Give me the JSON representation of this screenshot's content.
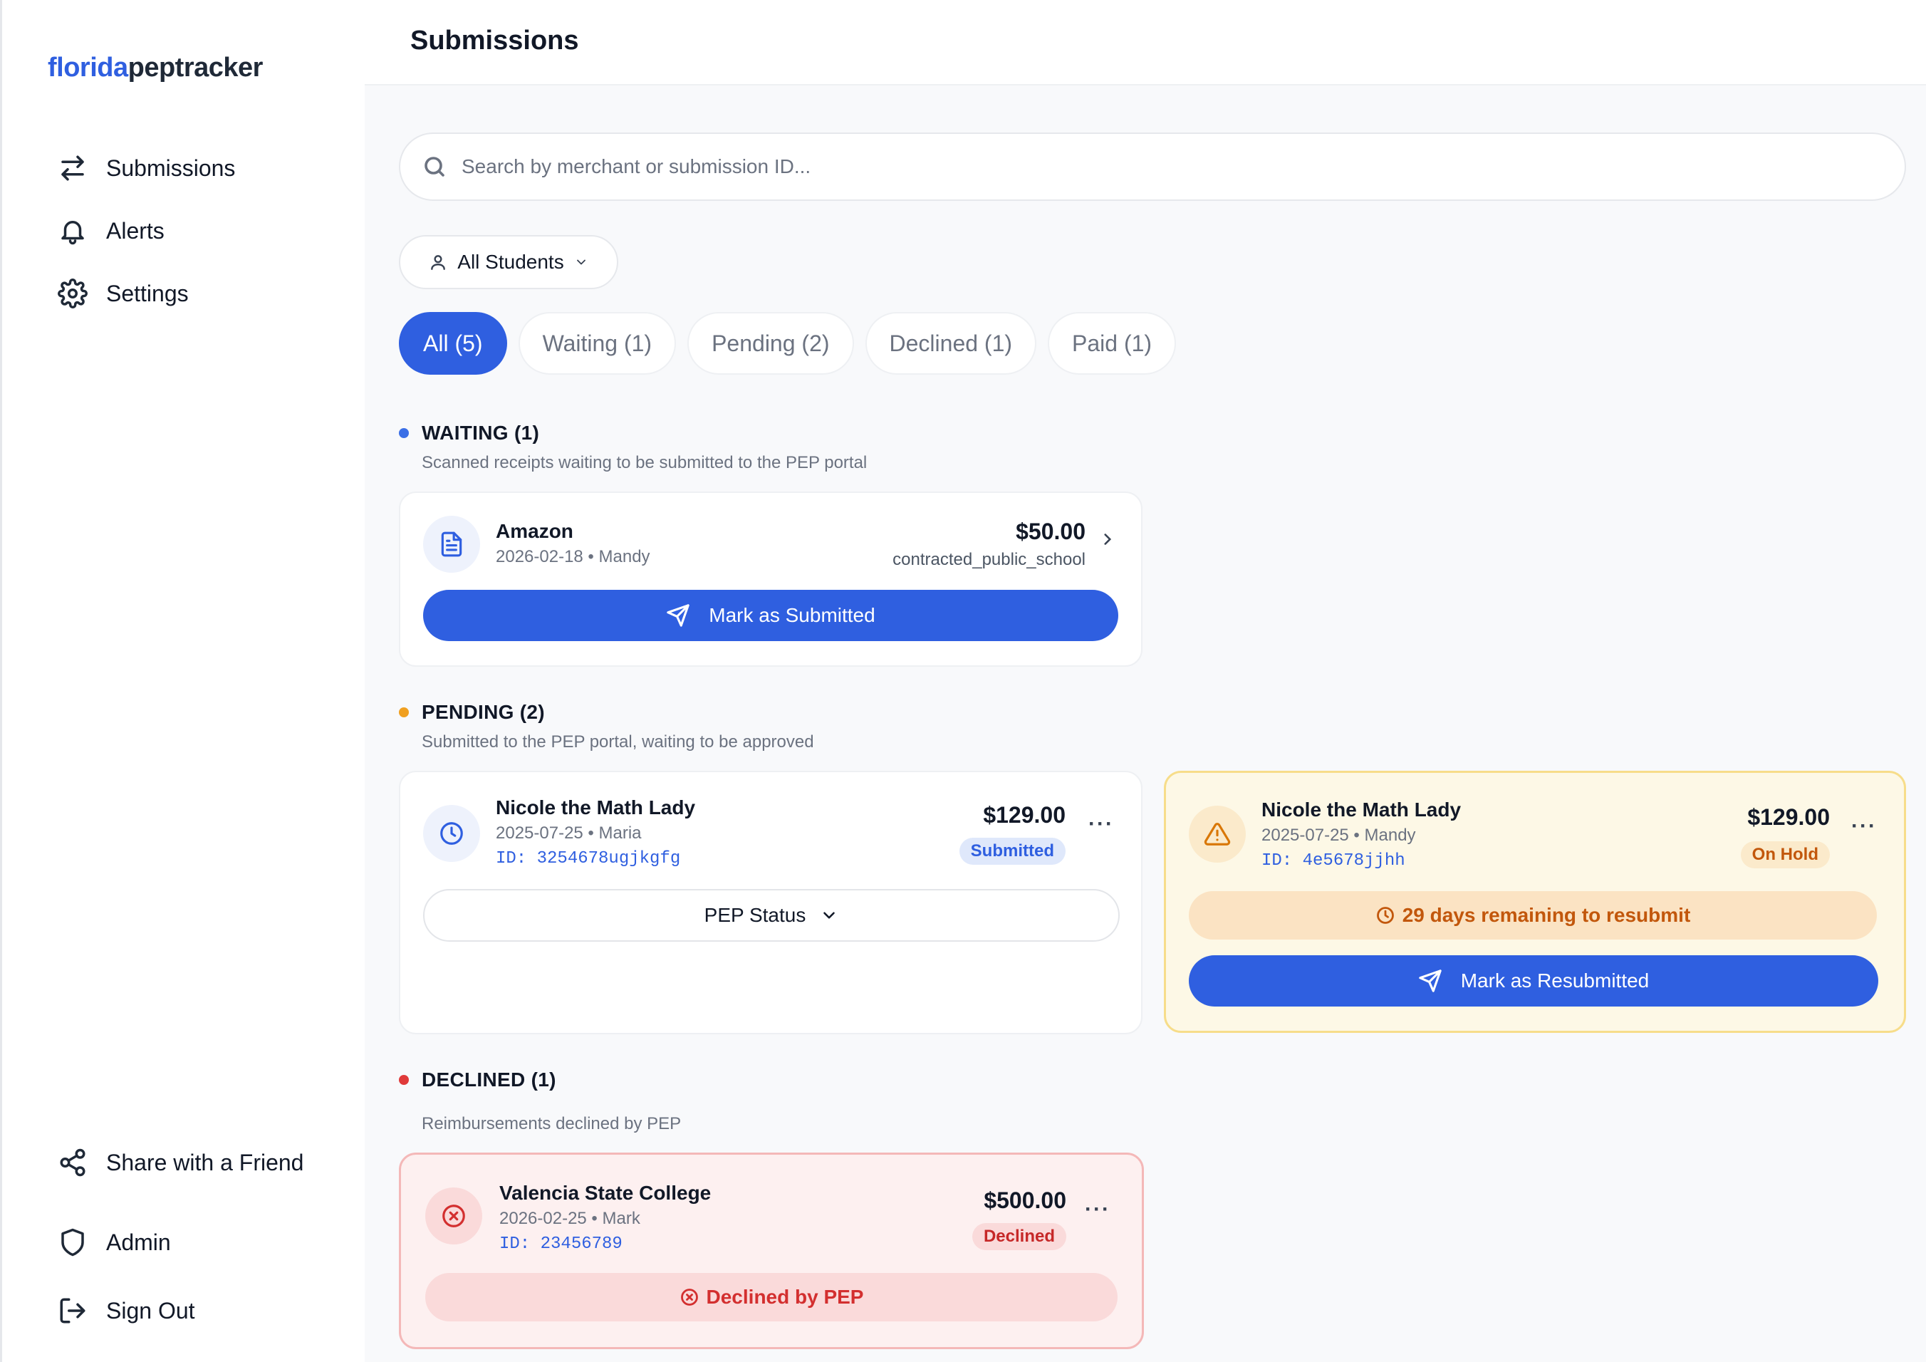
{
  "brand": {
    "part1": "florida",
    "part2": "peptracker"
  },
  "sidebar": {
    "items": [
      {
        "label": "Submissions",
        "icon": "arrows-swap-icon"
      },
      {
        "label": "Alerts",
        "icon": "bell-icon"
      },
      {
        "label": "Settings",
        "icon": "gear-icon"
      }
    ],
    "bottom_items": [
      {
        "label": "Share with a Friend",
        "icon": "share-icon"
      },
      {
        "label": "Admin",
        "icon": "shield-icon"
      },
      {
        "label": "Sign Out",
        "icon": "sign-out-icon"
      }
    ]
  },
  "header": {
    "title": "Submissions"
  },
  "search": {
    "placeholder": "Search by merchant or submission ID...",
    "value": ""
  },
  "filter": {
    "student_label": "All Students"
  },
  "tabs": [
    {
      "label": "All (5)",
      "active": true
    },
    {
      "label": "Waiting (1)",
      "active": false
    },
    {
      "label": "Pending (2)",
      "active": false
    },
    {
      "label": "Declined (1)",
      "active": false
    },
    {
      "label": "Paid (1)",
      "active": false
    }
  ],
  "sections": {
    "waiting": {
      "title": "WAITING (1)",
      "subtitle": "Scanned receipts waiting to be submitted to the PEP portal",
      "color": "#3b6fe6",
      "card": {
        "merchant": "Amazon",
        "meta": "2026-02-18 • Mandy",
        "amount": "$50.00",
        "category": "contracted_public_school",
        "action": "Mark as Submitted"
      }
    },
    "pending": {
      "title": "PENDING (2)",
      "subtitle": "Submitted to the PEP portal, waiting to be approved",
      "color": "#f0a020",
      "cards": [
        {
          "merchant": "Nicole the Math Lady",
          "meta": "2025-07-25 • Maria",
          "id": "ID: 3254678ugjkgfg",
          "amount": "$129.00",
          "badge": "Submitted",
          "status_button": "PEP Status"
        },
        {
          "merchant": "Nicole the Math Lady",
          "meta": "2025-07-25 • Mandy",
          "id": "ID: 4e5678jjhh",
          "amount": "$129.00",
          "badge": "On Hold",
          "notice": "29 days remaining to resubmit",
          "action": "Mark as Resubmitted"
        }
      ]
    },
    "declined": {
      "title": "DECLINED (1)",
      "subtitle": "Reimbursements declined by PEP",
      "color": "#e03a3a",
      "card": {
        "merchant": "Valencia State College",
        "meta": "2026-02-25 • Mark",
        "id": "ID: 23456789",
        "amount": "$500.00",
        "badge": "Declined",
        "notice": "Declined by PEP"
      }
    }
  },
  "colors": {
    "accent": "#2f5fe0",
    "hold": "#fdf8e6",
    "declined": "#fdf0f0"
  }
}
